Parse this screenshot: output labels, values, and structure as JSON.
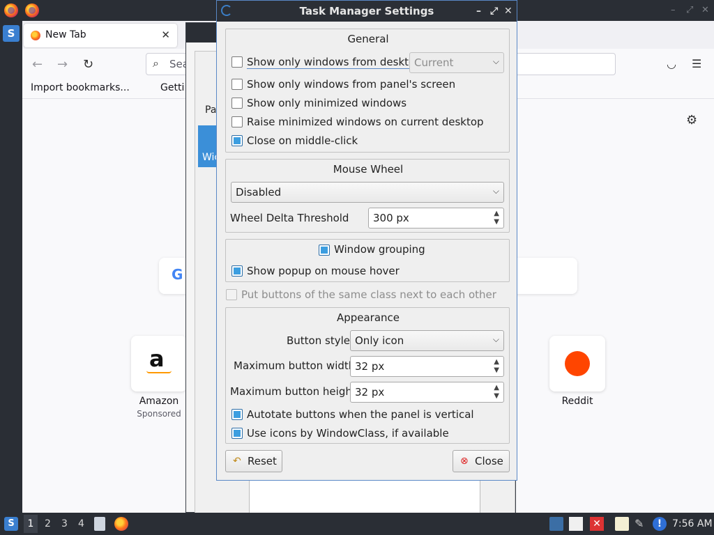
{
  "topbar": {
    "min": "–",
    "max": "⤢",
    "close": "✕"
  },
  "browser": {
    "tab_title": "New Tab",
    "tab_close": "✕",
    "back": "←",
    "forward": "→",
    "reload": "↻",
    "url_placeholder": "Sea",
    "pocket_icon": "pocket-icon",
    "menu_icon": "☰",
    "bookmarks": [
      "Import bookmarks...",
      "Getti"
    ],
    "settings_icon": "⚙",
    "shortcuts": [
      {
        "label": "Amazon",
        "sublabel": "Sponsored"
      },
      {
        "label": "Reddit",
        "sublabel": ""
      }
    ]
  },
  "bg_dialog": {
    "item1": "Pa",
    "item2": "Wic"
  },
  "dialog": {
    "title": "Task Manager Settings",
    "controls": {
      "minimize": "–",
      "maximize": "⤢",
      "close": "✕"
    },
    "general": {
      "title": "General",
      "desktop_only": {
        "label": "Show only windows from desktop",
        "checked": false
      },
      "desktop_combo": "Current",
      "panel_screen": {
        "label": "Show only windows from panel's screen",
        "checked": false
      },
      "minimized_only": {
        "label": "Show only minimized windows",
        "checked": false
      },
      "raise_minimized": {
        "label": "Raise minimized windows on current desktop",
        "checked": false
      },
      "close_middle": {
        "label": "Close on middle-click",
        "checked": true
      }
    },
    "mouse_wheel": {
      "title": "Mouse Wheel",
      "mode": "Disabled",
      "delta_label": "Wheel Delta Threshold",
      "delta_value": "300 px"
    },
    "grouping": {
      "window_grouping": {
        "label": "Window grouping",
        "checked": true
      },
      "popup_hover": {
        "label": "Show popup on mouse hover",
        "checked": true
      }
    },
    "same_class": {
      "label": "Put buttons of the same class next to each other",
      "checked": false
    },
    "appearance": {
      "title": "Appearance",
      "button_style_label": "Button style",
      "button_style_value": "Only icon",
      "max_width_label": "Maximum button width",
      "max_width_value": "32 px",
      "max_height_label": "Maximum button height",
      "max_height_value": "32 px",
      "autorotate": {
        "label": "Autotate buttons when the panel is vertical",
        "checked": true
      },
      "window_class_icons": {
        "label": "Use icons by WindowClass, if available",
        "checked": true
      }
    },
    "reset_label": "Reset",
    "close_label": "Close"
  },
  "taskbar": {
    "workspaces": [
      "1",
      "2",
      "3",
      "4"
    ],
    "clock": "7:56 AM"
  },
  "colors": {
    "accent": "#3c9ee0",
    "titlebar": "#2b2f36",
    "panel": "#2a2e35"
  }
}
